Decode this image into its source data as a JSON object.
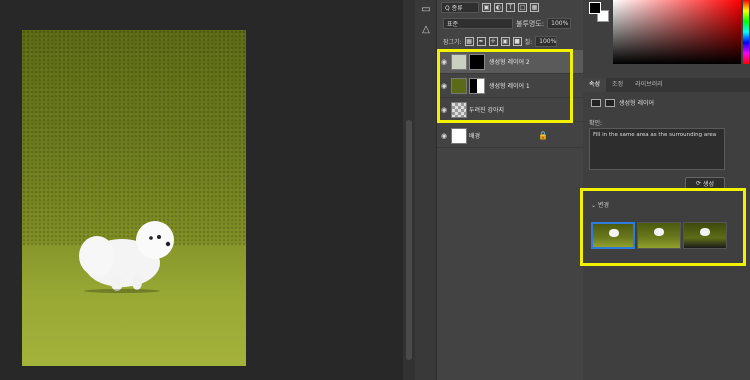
{
  "layers": {
    "search_label": "Q 종류",
    "blend_mode": "표준",
    "opacity_label": "불투명도:",
    "opacity_value": "100%",
    "lock_label": "잠그기:",
    "fill_label": "칠:",
    "fill_value": "100%",
    "items": [
      {
        "name": "생성형 레이어 2"
      },
      {
        "name": "생성형 레이어 1"
      },
      {
        "name": "두려진 강아지"
      },
      {
        "name": "배경"
      }
    ]
  },
  "properties": {
    "tabs": [
      "속성",
      "조정",
      "라이브러리"
    ],
    "header": "생성형 레이어",
    "prompt_label": "확인:",
    "prompt_text": "Fill in the same area as the surrounding area",
    "generate_label": "생성",
    "variations_label": "변경"
  },
  "colors": {
    "highlight": "#f2f200",
    "selected_variation": "#2f7bdc"
  }
}
